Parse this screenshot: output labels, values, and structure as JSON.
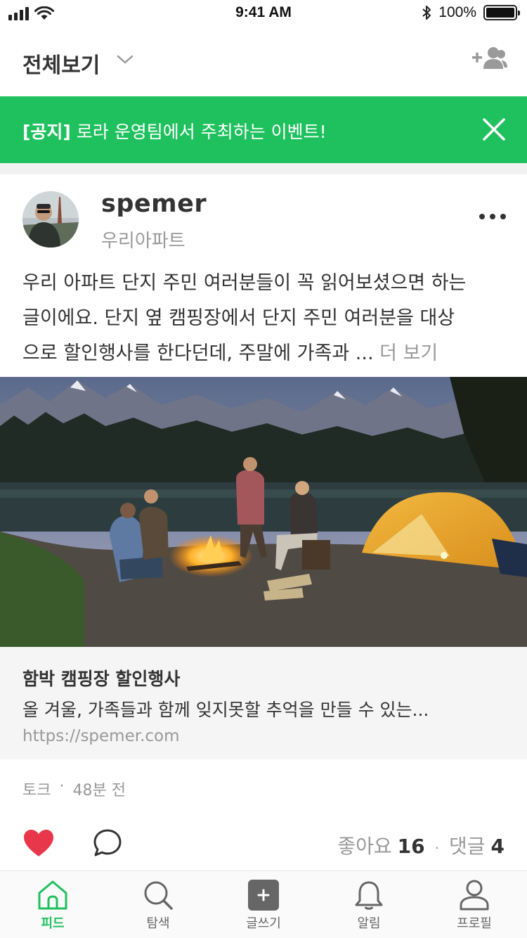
{
  "status_bar": {
    "time": "9:41 AM",
    "battery": "100%"
  },
  "header": {
    "title": "전체보기"
  },
  "notice": {
    "tag": "[공지]",
    "text": " 로라 운영팀에서 주최하는 이벤트!"
  },
  "post": {
    "author": "spemer",
    "community": "우리아파트",
    "body_lines": [
      "우리 아파트 단지 주민 여러분들이 꼭 읽어보셨으면 하는",
      "글이에요. 단지 옆 캠핑장에서 단지 주민 여러분을 대상",
      "으로 할인행사를 한다던데, 주말에 가족과 ... "
    ],
    "see_more": "더 보기",
    "link": {
      "title": "함박 캠핑장 할인행사",
      "description": "올 겨울, 가족들과 함께 잊지못할 추억을 만들 수 있는...",
      "url": "https://spemer.com"
    },
    "category": "토크",
    "time": "48분 전",
    "likes_label": "좋아요",
    "likes": "16",
    "comments_label": "댓글",
    "comments": "4"
  },
  "tabs": [
    {
      "label": "피드",
      "icon": "home-icon",
      "active": true
    },
    {
      "label": "탐색",
      "icon": "search-icon",
      "active": false
    },
    {
      "label": "글쓰기",
      "icon": "plus-square-icon",
      "active": false
    },
    {
      "label": "알림",
      "icon": "bell-icon",
      "active": false
    },
    {
      "label": "프로필",
      "icon": "person-icon",
      "active": false
    }
  ],
  "colors": {
    "accent": "#1fc15e",
    "like": "#e8364a",
    "text": "#333333",
    "muted": "#999999"
  }
}
